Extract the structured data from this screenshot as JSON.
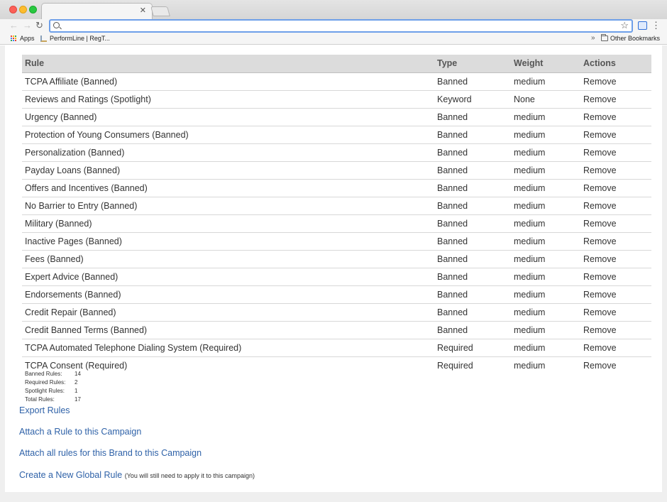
{
  "browser": {
    "tab": {
      "title": ""
    },
    "address": {
      "value": ""
    },
    "bookmarks": {
      "apps_label": "Apps",
      "site_label": "PerformLine | RegT...",
      "overflow_label": "»",
      "other_label": "Other Bookmarks"
    },
    "icons": {
      "back": "arrow-left-icon",
      "forward": "arrow-right-icon",
      "reload": "reload-icon",
      "star": "star-icon",
      "menu": "vertical-dots-icon"
    }
  },
  "table": {
    "headers": {
      "rule": "Rule",
      "type": "Type",
      "weight": "Weight",
      "actions": "Actions"
    },
    "rows": [
      {
        "rule": "TCPA Affiliate (Banned)",
        "type": "Banned",
        "weight": "medium",
        "action": "Remove"
      },
      {
        "rule": "Reviews and Ratings (Spotlight)",
        "type": "Keyword",
        "weight": "None",
        "action": "Remove"
      },
      {
        "rule": "Urgency (Banned)",
        "type": "Banned",
        "weight": "medium",
        "action": "Remove"
      },
      {
        "rule": "Protection of Young Consumers (Banned)",
        "type": "Banned",
        "weight": "medium",
        "action": "Remove"
      },
      {
        "rule": "Personalization (Banned)",
        "type": "Banned",
        "weight": "medium",
        "action": "Remove"
      },
      {
        "rule": "Payday Loans (Banned)",
        "type": "Banned",
        "weight": "medium",
        "action": "Remove"
      },
      {
        "rule": "Offers and Incentives (Banned)",
        "type": "Banned",
        "weight": "medium",
        "action": "Remove"
      },
      {
        "rule": "No Barrier to Entry (Banned)",
        "type": "Banned",
        "weight": "medium",
        "action": "Remove"
      },
      {
        "rule": "Military (Banned)",
        "type": "Banned",
        "weight": "medium",
        "action": "Remove"
      },
      {
        "rule": "Inactive Pages (Banned)",
        "type": "Banned",
        "weight": "medium",
        "action": "Remove"
      },
      {
        "rule": "Fees (Banned)",
        "type": "Banned",
        "weight": "medium",
        "action": "Remove"
      },
      {
        "rule": "Expert Advice (Banned)",
        "type": "Banned",
        "weight": "medium",
        "action": "Remove"
      },
      {
        "rule": "Endorsements (Banned)",
        "type": "Banned",
        "weight": "medium",
        "action": "Remove"
      },
      {
        "rule": "Credit Repair (Banned)",
        "type": "Banned",
        "weight": "medium",
        "action": "Remove"
      },
      {
        "rule": "Credit Banned Terms (Banned)",
        "type": "Banned",
        "weight": "medium",
        "action": "Remove"
      },
      {
        "rule": "TCPA Automated Telephone Dialing System (Required)",
        "type": "Required",
        "weight": "medium",
        "action": "Remove"
      },
      {
        "rule": "TCPA Consent (Required)",
        "type": "Required",
        "weight": "medium",
        "action": "Remove"
      }
    ]
  },
  "summary": [
    {
      "label": "Banned Rules:",
      "value": "14"
    },
    {
      "label": "Required Rules:",
      "value": "2"
    },
    {
      "label": "Spotlight Rules:",
      "value": "1"
    },
    {
      "label": "Total Rules:",
      "value": "17"
    }
  ],
  "links": {
    "export": "Export Rules",
    "attach": "Attach a Rule to this Campaign",
    "attach_all": "Attach all rules for this Brand to this Campaign",
    "create": "Create a New Global Rule",
    "create_note": "(You will still need to apply it to this campaign)"
  },
  "colors": {
    "link": "#2f62a8",
    "header_bg": "#dcdcdc",
    "apps_grid": [
      "#e94235",
      "#fbbc04",
      "#34a853",
      "#4285f4",
      "#e94235",
      "#fbbc04",
      "#34a853",
      "#4285f4",
      "#e94235"
    ]
  }
}
